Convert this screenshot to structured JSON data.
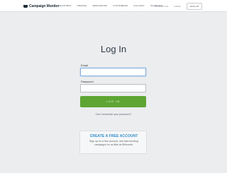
{
  "header": {
    "brand": "Campaign Monitor",
    "nav": [
      "FEATURES",
      "PRICING",
      "RESOURCES",
      "CUSTOMERS",
      "GALLERY",
      "AGENCIES"
    ],
    "contact_link": "CONTACT US",
    "login_link": "LOGIN",
    "signup_label": "SIGN UP"
  },
  "login": {
    "title": "Log In",
    "email_label": "Email",
    "email_value": "",
    "password_label": "Password",
    "password_value": "",
    "submit_label": "LOG IN",
    "forgot_label": "Can't remember your password?"
  },
  "signup_card": {
    "title": "CREATE A FREE ACCOUNT",
    "text": "Sign up for a free account, and start sending campaigns for as little as $9/month."
  },
  "colors": {
    "accent_green": "#5ea533",
    "link_blue": "#2e8ec9",
    "background": "#ecedef"
  }
}
